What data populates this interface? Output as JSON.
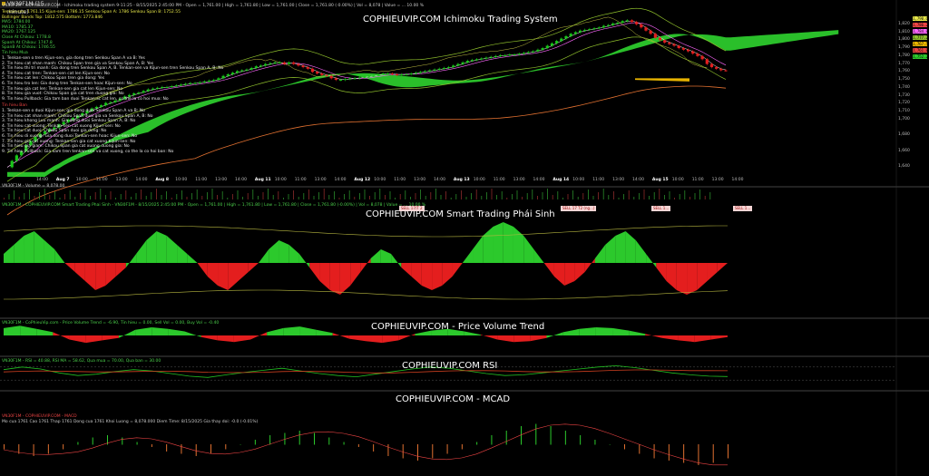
{
  "tab": {
    "label": "VN30F1M (15 minute)"
  },
  "panels": [
    {
      "id": "ichimoku",
      "title": "COPHIEUVIP.COM Ichimoku Trading System"
    },
    {
      "id": "smart",
      "title": "COPHIEUVIP.COM Smart Trading Phái Sinh"
    },
    {
      "id": "pvt",
      "title": "COPHIEUVIP.COM - Price Volume Trend"
    },
    {
      "id": "rsi",
      "title": "COPHIEUVIP.COM RSI"
    },
    {
      "id": "macd",
      "title": "COPHIEUVIP.COM - MCAD"
    }
  ],
  "header": {
    "main": "VN30F1M - COPHIEUVIP.COM - Ichimoku trading system 9-11:25 - 8/15/2025 2:45:00 PM - Open = 1,761.00 | High = 1,761.80 | Low = 1,761.00 | Close = 1,761.80 (-0.00%) | Vol = 8,078 | Value = ... 10.00 %",
    "lines": [
      {
        "text": "Tenkan-sen: 1761.15   Kijun-sen: 1786.15   Senkou Span A: 1786   Senkou Span B: 1752.55",
        "color": "#e8e84a"
      },
      {
        "text": "Bollinger Bands Top: 1812.575   Bottom: 1773.846",
        "color": "#e8e84a"
      },
      {
        "text": "MA5: 1784.00",
        "color": "#4cd24c"
      },
      {
        "text": "MA10: 1785.37",
        "color": "#4cd24c"
      },
      {
        "text": "MA20: 1767.125",
        "color": "#4cd24c"
      },
      {
        "text": "Close At Chikou: 1778.8",
        "color": "#4cd24c"
      },
      {
        "text": "Spanh At Chikou: 1747.8",
        "color": "#4cd24c"
      },
      {
        "text": "SpanB At Chikou: 1746.55",
        "color": "#4cd24c"
      }
    ],
    "buy_title": "Tin hieu Mua",
    "buy": [
      "1. Tenkan-sen o tren Kijun-sen, gia dong tren Senkou Span A va B: Yes",
      "2. Tin hieu cat nhan manh: Chikou Span tren gia va Senkou Span A, B: Yes",
      "3. Tin hieu thi tri manh: Gia dong tren Senkou Span A, B. Tenkan-sen va Kijun-sen tren Senkou Span A, B: No",
      "4. Tin hieu cat tren: Tenkan-sen cat len Kijun-sen: No",
      "5. Tin hieu cat len: Chikou Span tren gia dong: Yes",
      "6. Tin hieu tro len: Gia dong tren Tenkan-sen hoac Kijun-sen: No",
      "7. Tin hieu gia cat len: Tenkan-sen gia cat len Kijun-sen: No",
      "8. Tin hieu gia vuot: Chikou Span gia cat tren duong gia: No",
      "9. Tin hieu Pullback: Gia tam ban duoi Tenkan-sc cat len, co the la co hoi mua: No"
    ],
    "sell_title": "Tin hieu Ban",
    "sell": [
      "1. Tenkan-sen o duoi Kijun-sen, gia dong duoi Senkou Span A va B: No",
      "2. Tin hieu cat nhan manh: Chikou Span duoi gia va Senkou Span A, B: No",
      "3. Tin hieu khong Luu manh: Gia dong duoi Senkou Span A, B: No",
      "4. Tin hieu cat xuong: Tenkan-sen cat xuong Kijun-sen: No",
      "5. Tin hieu cat duoi: Chikou Span duoi gia dong: No",
      "6. Tin hieu di xuong: Gia dong duoi Tenkan-sen hoac Kijun-sen: No",
      "7. Tin hieu gia cat xuong: Tenkan-sen gia cat xuong Kijun-sen: No",
      "8. Tin hieu gia giam: Chikou Span gia cat xuong duong gia: No",
      "9. Tin hieu Pullback: Gia xam tren tenkan-sen va cat xuong, co the la co hoi ban: No"
    ]
  },
  "volume_line": "VN30F1M - Volume = 8,078.00",
  "smart_line": "VN30F1M - COPHIEUVIP.COM Smart Trading Phai Sinh - VN30F1M - 8/15/2025 2:45:00 PM - Open = 1,761.00 | High = 1,761.80 | Low = 1,761.80 | Close = 1,761.80 (-0.00%) | Vol = 8,078 | Value = ... 10.00 %",
  "pvt_line": "VN30F1M - CoPhieuVip.com - Price Volume Trend = -6.90,   Tin hieu = 0.00,   Sell Vol = 0.00,   Buy Vol = -0.40",
  "rsi_line": "VN30F1M - RSI = 40.88,   RSI MA = 58.62,   Qua mua = 70.00,   Qua ban = 30.00",
  "macd_line": "VN30F1M - COPHIEUVIP.COM - MACD",
  "macd_sub": "Mo cua 1761   Cao 1761   Thap 1761   Dong cua 1761   Khoi Luong = 8,078.000   Diem Time: 8/15/2025   Gia thay doi: -0.0 (-0.01%)",
  "signals": [
    "SELL 17/T 2",
    "SELL 17 T2 (ng...)",
    "SELL 1...",
    "SELL 1..."
  ],
  "x_labels": [
    {
      "t": "14:00"
    },
    {
      "t": "Aug 7",
      "b": true
    },
    {
      "t": "10:00"
    },
    {
      "t": "11:00"
    },
    {
      "t": "13:00"
    },
    {
      "t": "14:00"
    },
    {
      "t": "Aug 8",
      "b": true
    },
    {
      "t": "10:00"
    },
    {
      "t": "11:00"
    },
    {
      "t": "13:00"
    },
    {
      "t": "14:00"
    },
    {
      "t": "Aug 11",
      "b": true
    },
    {
      "t": "10:00"
    },
    {
      "t": "11:00"
    },
    {
      "t": "13:00"
    },
    {
      "t": "14:00"
    },
    {
      "t": "Aug 12",
      "b": true
    },
    {
      "t": "10:00"
    },
    {
      "t": "11:00"
    },
    {
      "t": "13:00"
    },
    {
      "t": "14:00"
    },
    {
      "t": "Aug 13",
      "b": true
    },
    {
      "t": "10:00"
    },
    {
      "t": "11:00"
    },
    {
      "t": "13:00"
    },
    {
      "t": "14:00"
    },
    {
      "t": "Aug 14",
      "b": true
    },
    {
      "t": "10:00"
    },
    {
      "t": "11:00"
    },
    {
      "t": "13:00"
    },
    {
      "t": "14:00"
    },
    {
      "t": "Aug 15",
      "b": true
    },
    {
      "t": "10:00"
    },
    {
      "t": "11:00"
    },
    {
      "t": "13:00"
    },
    {
      "t": "14:00"
    }
  ],
  "colors": {
    "up": "#18c818",
    "down": "#e41e1e",
    "cloud_bull": "#2cc92c",
    "cloud_bear": "#e8b400",
    "bg": "#000000"
  },
  "chart_data": [
    {
      "type": "line",
      "title": "COPHIEUVIP.COM Ichimoku Trading System",
      "ylim": [
        1620,
        1830
      ],
      "y_ticks": [
        1640,
        1660,
        1680,
        1700,
        1710,
        1720,
        1730,
        1740,
        1750,
        1760,
        1770,
        1780,
        1790,
        1800,
        1810,
        1820
      ],
      "last_close": 1761.8,
      "price_labels": [
        "1,790.6",
        "1,786.2",
        "1,784.8",
        "1,777.2",
        "1,767.5",
        "1,761.8",
        "1,752.2"
      ],
      "close": [
        1640,
        1648,
        1655,
        1660,
        1668,
        1673,
        1678,
        1682,
        1685,
        1688,
        1690,
        1694,
        1697,
        1700,
        1702,
        1705,
        1708,
        1711,
        1714,
        1716,
        1718,
        1721,
        1722,
        1724,
        1726,
        1729,
        1731,
        1733,
        1734,
        1736,
        1738,
        1739,
        1740,
        1741,
        1741,
        1742,
        1743,
        1744,
        1745,
        1746,
        1746,
        1747,
        1748,
        1749,
        1750,
        1752,
        1755,
        1757,
        1759,
        1761,
        1762,
        1763,
        1765,
        1767,
        1768,
        1770,
        1771,
        1772,
        1772,
        1770,
        1772,
        1770,
        1768,
        1766,
        1764,
        1760,
        1758,
        1756,
        1755,
        1752,
        1750,
        1750,
        1751,
        1752,
        1752,
        1753,
        1754,
        1755,
        1756,
        1757,
        1758,
        1758,
        1757,
        1756,
        1757,
        1757,
        1758,
        1759,
        1760,
        1761,
        1762,
        1763,
        1764,
        1765,
        1766,
        1768,
        1770,
        1772,
        1774,
        1775,
        1776,
        1777,
        1778,
        1779,
        1780,
        1781,
        1781,
        1782,
        1782,
        1783,
        1784,
        1785,
        1786,
        1788,
        1790,
        1793,
        1796,
        1799,
        1802,
        1805,
        1808,
        1810,
        1812,
        1813,
        1814,
        1815,
        1816,
        1818,
        1819,
        1821,
        1822,
        1824,
        1825,
        1823,
        1820,
        1816,
        1812,
        1808,
        1803,
        1800,
        1797,
        1795,
        1793,
        1790,
        1788,
        1786,
        1783,
        1780,
        1776,
        1770,
        1766,
        1764,
        1762,
        1761.8
      ],
      "tenkan_last": 1761.15,
      "kijun_last": 1786.15,
      "senkou_a_last": 1786,
      "senkou_b_last": 1752.55
    },
    {
      "type": "area",
      "title": "COPHIEUVIP.COM Smart Trading Phái Sinh",
      "ylim": [
        -10,
        10
      ],
      "series": [
        {
          "values": [
            2,
            4,
            6,
            7,
            5,
            3,
            0,
            -2,
            -4,
            -6,
            -5,
            -3,
            -1,
            2,
            5,
            7,
            6,
            4,
            2,
            0,
            -3,
            -5,
            -6,
            -4,
            -2,
            0,
            3,
            5,
            4,
            2,
            -1,
            -4,
            -6,
            -7,
            -5,
            -2,
            1,
            3,
            2,
            -1,
            -3,
            -5,
            -6,
            -5,
            -3,
            0,
            3,
            6,
            8,
            9,
            8,
            6,
            3,
            0,
            -3,
            -5,
            -4,
            -2,
            1,
            4,
            6,
            7,
            5,
            2,
            -1,
            -4,
            -6,
            -7,
            -6,
            -4,
            -2,
            0
          ]
        }
      ]
    },
    {
      "type": "bar",
      "title": "COPHIEUVIP.COM - Price Volume Trend",
      "ylim": [
        -2,
        2
      ],
      "series": [
        {
          "values": [
            0.9,
            1.2,
            0.8,
            0.4,
            -0.5,
            -0.9,
            -0.6,
            -0.3,
            0.7,
            1.0,
            0.8,
            0.5,
            -0.2,
            -0.6,
            -0.8,
            -0.5,
            0.4,
            0.9,
            1.1,
            0.7,
            0.3,
            -0.4,
            -0.7,
            -0.9,
            -0.6,
            0.2,
            0.6,
            0.8,
            0.5,
            0.1,
            -0.5,
            -0.8,
            -0.7,
            -0.3,
            0.4,
            0.8,
            1.0,
            0.9,
            0.6,
            0.2,
            -0.3,
            -0.6,
            -0.8,
            -0.5,
            -0.2
          ]
        }
      ]
    },
    {
      "type": "line",
      "title": "COPHIEUVIP.COM RSI",
      "ylim": [
        0,
        100
      ],
      "series": [
        {
          "values": [
            62,
            70,
            64,
            52,
            44,
            48,
            56,
            62,
            58,
            50,
            42,
            38,
            46,
            54,
            60,
            66,
            58,
            50,
            44,
            40,
            48,
            56,
            64,
            70,
            66,
            58,
            50,
            44,
            46,
            52,
            58,
            64,
            70,
            74,
            68,
            60,
            52,
            46,
            42,
            40.88
          ]
        },
        {
          "values": [
            55,
            57,
            58,
            57,
            56,
            55,
            55,
            56,
            57,
            57,
            56,
            54,
            53,
            53,
            54,
            56,
            57,
            56,
            55,
            53,
            52,
            52,
            54,
            56,
            58,
            59,
            59,
            58,
            56,
            55,
            55,
            56,
            58,
            60,
            61,
            61,
            60,
            59,
            59,
            58.62
          ]
        }
      ],
      "levels": [
        70,
        30
      ]
    },
    {
      "type": "bar",
      "title": "COPHIEUVIP.COM - MCAD",
      "ylim": [
        -6,
        6
      ],
      "series": [
        {
          "values": [
            -1,
            -2,
            -2.5,
            -2,
            -1,
            0.5,
            1.5,
            2,
            1.5,
            0.5,
            -0.5,
            -1.5,
            -2,
            -2.5,
            -2,
            -1,
            0,
            1,
            2,
            2.5,
            3,
            2.5,
            1.5,
            0.5,
            -0.5,
            -1.5,
            -2.5,
            -3,
            -3.5,
            -3,
            -2,
            -1,
            0.5,
            2,
            3,
            4,
            4.5,
            4,
            3,
            2,
            1,
            0,
            -1,
            -2,
            -3,
            -3.5,
            -4,
            -4.5,
            -4,
            -3
          ]
        }
      ]
    }
  ]
}
